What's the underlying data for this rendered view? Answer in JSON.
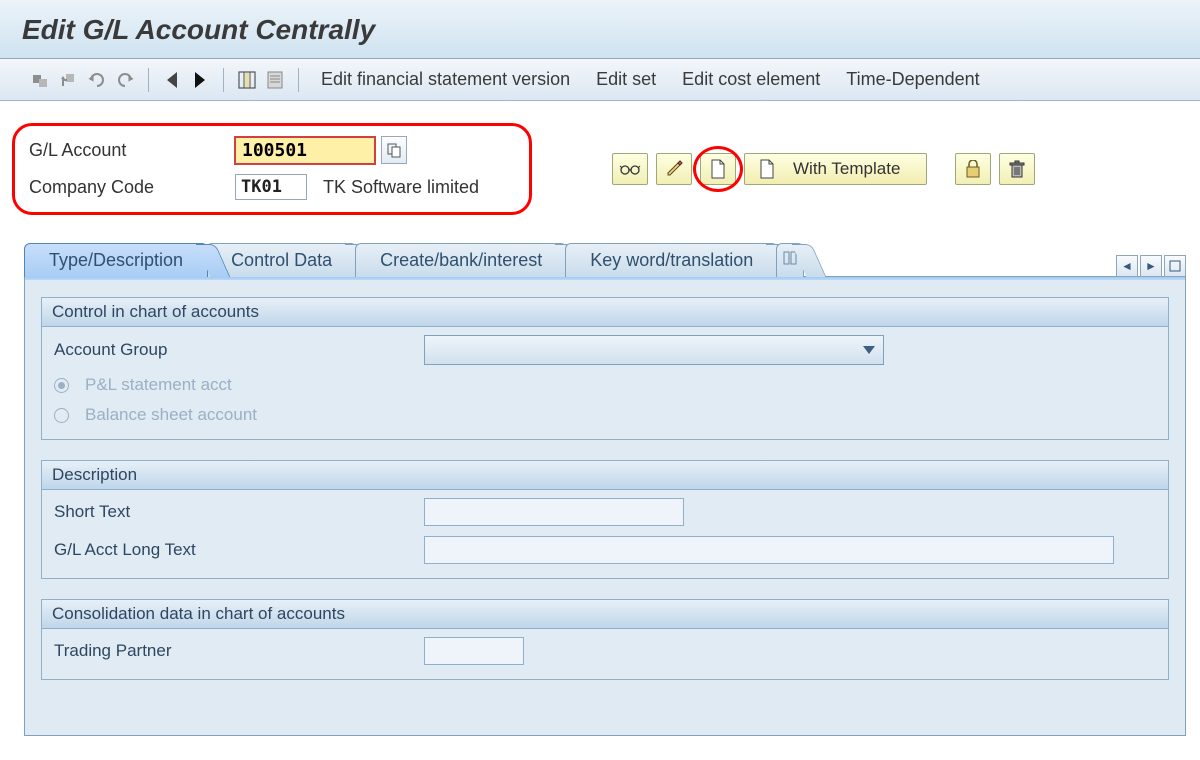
{
  "title": "Edit G/L Account Centrally",
  "toolbar_links": {
    "efsv": "Edit financial statement version",
    "editset": "Edit set",
    "editcost": "Edit cost element",
    "timedep": "Time-Dependent"
  },
  "selection": {
    "gl_label": "G/L Account",
    "gl_value": "100501",
    "cc_label": "Company Code",
    "cc_value": "TK01",
    "cc_desc": "TK Software limited",
    "with_template": "With Template"
  },
  "tabs": {
    "t0": "Type/Description",
    "t1": "Control Data",
    "t2": "Create/bank/interest",
    "t3": "Key word/translation"
  },
  "group1": {
    "title": "Control in chart of accounts",
    "account_group": "Account Group",
    "pl": "P&L statement acct",
    "bs": "Balance sheet account"
  },
  "group2": {
    "title": "Description",
    "short_text": "Short Text",
    "long_text": "G/L Acct Long Text"
  },
  "group3": {
    "title": "Consolidation data in chart of accounts",
    "trading_partner": "Trading Partner"
  }
}
